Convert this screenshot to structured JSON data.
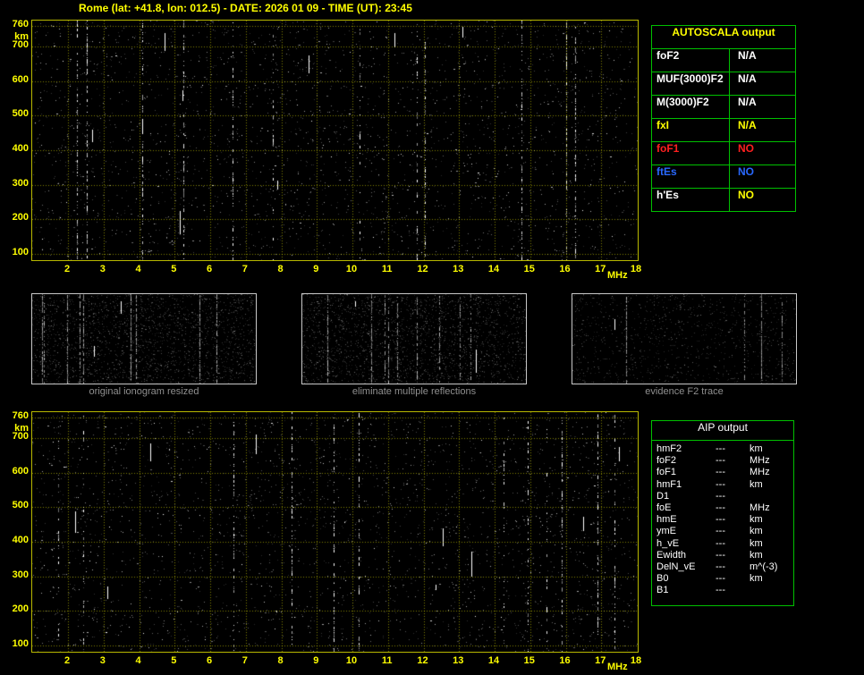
{
  "title": "Rome (lat: +41.8, lon: 012.5) - DATE: 2026 01 09 - TIME (UT): 23:45",
  "colors": {
    "background": "#000000",
    "axis_yellow": "#ffff00",
    "plot_border": "#b8b800",
    "grid": "rgba(255,255,0,0.5)",
    "table_border": "#00c000",
    "caption_gray": "#8f8f8f"
  },
  "ionogram": {
    "y_unit": "km",
    "x_unit": "MHz",
    "y_ticks": [
      760,
      700,
      600,
      500,
      400,
      300,
      200,
      100
    ],
    "x_ticks": [
      2,
      3,
      4,
      5,
      6,
      7,
      8,
      9,
      10,
      11,
      12,
      13,
      14,
      15,
      16,
      17,
      18
    ],
    "x_range_mhz": [
      1,
      18
    ],
    "y_range_km": [
      82,
      775
    ],
    "content_note": "noise speckle only, no echo trace detected"
  },
  "thumbnails": [
    {
      "caption": "original ionogram resized"
    },
    {
      "caption": "eliminate multiple reflections"
    },
    {
      "caption": "evidence F2 trace"
    }
  ],
  "autoscala_table": {
    "header": "AUTOSCALA output",
    "rows": [
      {
        "label": "foF2",
        "value": "N/A",
        "label_color": "#ffffff",
        "value_color": "#ffffff"
      },
      {
        "label": "MUF(3000)F2",
        "value": "N/A",
        "label_color": "#ffffff",
        "value_color": "#ffffff"
      },
      {
        "label": "M(3000)F2",
        "value": "N/A",
        "label_color": "#ffffff",
        "value_color": "#ffffff"
      },
      {
        "label": "fxI",
        "value": "N/A",
        "label_color": "#ffff00",
        "value_color": "#ffff00"
      },
      {
        "label": "foF1",
        "value": "NO",
        "label_color": "#ff2020",
        "value_color": "#ff2020"
      },
      {
        "label": "ftEs",
        "value": "NO",
        "label_color": "#2968ff",
        "value_color": "#2968ff"
      },
      {
        "label": "h'Es",
        "value": "NO",
        "label_color": "#ffffff",
        "value_color": "#ffff00"
      }
    ]
  },
  "aip_table": {
    "header": "AIP output",
    "rows": [
      {
        "name": "hmF2",
        "value": "---",
        "unit": "km"
      },
      {
        "name": "foF2",
        "value": "---",
        "unit": "MHz"
      },
      {
        "name": "foF1",
        "value": "---",
        "unit": "MHz"
      },
      {
        "name": "hmF1",
        "value": "---",
        "unit": "km"
      },
      {
        "name": "D1",
        "value": "---",
        "unit": ""
      },
      {
        "name": "foE",
        "value": "---",
        "unit": "MHz"
      },
      {
        "name": "hmE",
        "value": "---",
        "unit": "km"
      },
      {
        "name": "ymE",
        "value": "---",
        "unit": "km"
      },
      {
        "name": "h_vE",
        "value": "---",
        "unit": "km"
      },
      {
        "name": "Ewidth",
        "value": "---",
        "unit": "km"
      },
      {
        "name": "DelN_vE",
        "value": "---",
        "unit": "m^(-3)"
      },
      {
        "name": "B0",
        "value": "---",
        "unit": "km"
      },
      {
        "name": "B1",
        "value": "---",
        "unit": ""
      }
    ]
  }
}
